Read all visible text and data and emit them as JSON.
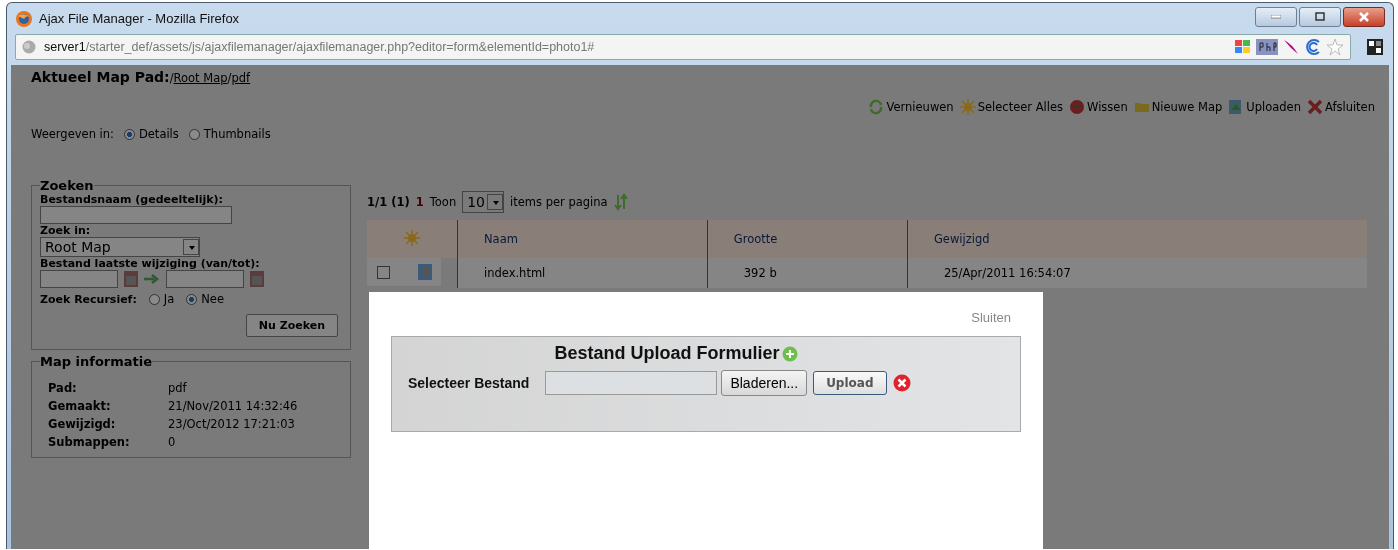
{
  "window": {
    "title": "Ajax File Manager - Mozilla Firefox"
  },
  "address_bar": {
    "host": "server1",
    "path": "/starter_def/assets/js/ajaxfilemanager/ajaxfilemanager.php?editor=form&elementId=photo1#"
  },
  "current_path": {
    "label": "Aktueel Map Pad:",
    "separator": "/",
    "crumbs": [
      "Root Map",
      "pdf"
    ]
  },
  "toolbar": [
    {
      "kind": "refresh",
      "label": "Vernieuwen"
    },
    {
      "kind": "select",
      "label": "Selecteer Alles"
    },
    {
      "kind": "delete",
      "label": "Wissen"
    },
    {
      "kind": "folder",
      "label": "Nieuwe Map"
    },
    {
      "kind": "upload",
      "label": "Uploaden"
    },
    {
      "kind": "close",
      "label": "Afsluiten"
    }
  ],
  "view": {
    "label": "Weergeven in:",
    "options": [
      {
        "label": "Details",
        "selected": true
      },
      {
        "label": "Thumbnails",
        "selected": false
      }
    ]
  },
  "search": {
    "legend": "Zoeken",
    "filename_label": "Bestandsnaam (gedeeltelijk):",
    "search_in_label": "Zoek in:",
    "search_in_value": "Root Map",
    "date_label": "Bestand laatste wijziging (van/tot):",
    "recursive_label": "Zoek Recursief:",
    "recursive_options": [
      {
        "label": "Ja",
        "selected": false
      },
      {
        "label": "Nee",
        "selected": true
      }
    ],
    "button": "Nu Zoeken"
  },
  "folder_info": {
    "legend": "Map informatie",
    "rows": [
      {
        "label": "Pad:",
        "value": "pdf"
      },
      {
        "label": "Gemaakt:",
        "value": "21/Nov/2011 14:32:46"
      },
      {
        "label": "Gewijzigd:",
        "value": "23/Oct/2012 17:21:03"
      },
      {
        "label": "Submappen:",
        "value": "0"
      }
    ]
  },
  "pagination": {
    "summary": "1/1 (1)",
    "page": "1",
    "show_label": "Toon",
    "per_page": "10",
    "per_page_suffix": "items per pagina"
  },
  "table": {
    "columns": [
      "Naam",
      "Grootte",
      "Gewijzigd"
    ],
    "rows": [
      {
        "checked": false,
        "name": "index.html",
        "size": "392 b",
        "modified": "25/Apr/2011 16:54:07"
      }
    ]
  },
  "dialog": {
    "close": "Sluiten",
    "title": "Bestand Upload Formulier",
    "file_label": "Selecteer Bestand",
    "browse_button": "Bladeren...",
    "upload_button": "Upload"
  }
}
